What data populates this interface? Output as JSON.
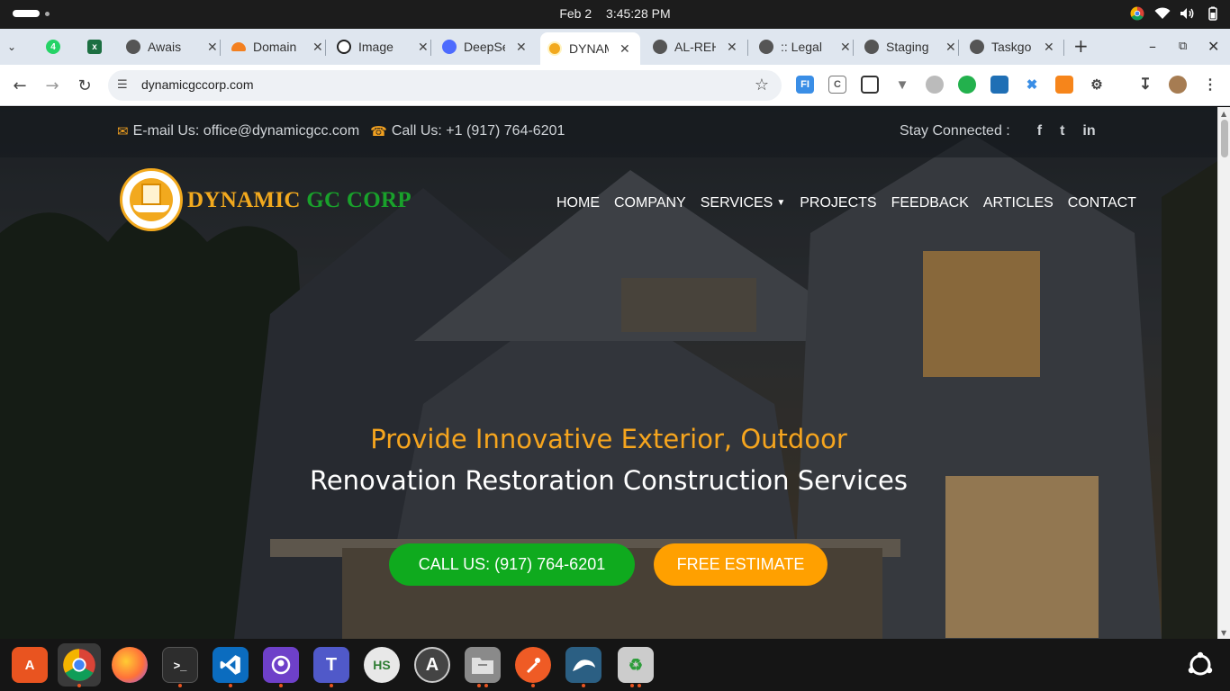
{
  "os": {
    "date": "Feb 2",
    "time": "3:45:28 PM"
  },
  "tabs": [
    {
      "title": "",
      "icon": "whatsapp-icon",
      "color": "#25d366"
    },
    {
      "title": "",
      "icon": "excel-icon",
      "color": "#1d6f42"
    },
    {
      "title": "Awais",
      "icon": "globe-icon",
      "color": "#555555"
    },
    {
      "title": "Domain",
      "icon": "cloudflare-icon",
      "color": "#f38020"
    },
    {
      "title": "Image",
      "icon": "openai-icon",
      "color": "#222222"
    },
    {
      "title": "DeepSeek",
      "icon": "deepseek-icon",
      "color": "#4d6bfe"
    },
    {
      "title": "DYNAMIC",
      "icon": "dynamic-gc-icon",
      "color": "#f2a91e"
    },
    {
      "title": "AL-REH",
      "icon": "globe-icon",
      "color": "#555555"
    },
    {
      "title": ":: Legal",
      "icon": "globe-icon",
      "color": "#555555"
    },
    {
      "title": "Staging",
      "icon": "globe-icon",
      "color": "#555555"
    },
    {
      "title": "Taskgo",
      "icon": "globe-icon",
      "color": "#555555"
    }
  ],
  "toolbar": {
    "url": "dynamicgccorp.com",
    "new_tab": "+"
  },
  "site": {
    "email_label": "E-mail Us: office@dynamicgcc.com",
    "phone_label": "Call Us: +1 (917) 764-6201",
    "stay_connected": "Stay Connected :",
    "social": [
      "f",
      "t",
      "in"
    ],
    "brand_part1": "DYNAMIC",
    "brand_part2": "GC CORP",
    "nav": [
      "HOME",
      "COMPANY",
      "SERVICES",
      "PROJECTS",
      "FEEDBACK",
      "ARTICLES",
      "CONTACT"
    ],
    "hero_line1": "Provide Innovative Exterior, Outdoor",
    "hero_line2": "Renovation Restoration Construction Services",
    "cta_call": "CALL US: (917) 764-6201",
    "cta_estimate": "FREE ESTIMATE"
  },
  "colors": {
    "accent_orange": "#f2a91e",
    "accent_green": "#19a12b",
    "call_button": "#0faa1e",
    "estimate_button": "#ffa000"
  },
  "dock": [
    {
      "name": "app-center-icon",
      "color": "#e95420",
      "label": "A"
    },
    {
      "name": "chrome-icon",
      "color": "#4285f4",
      "label": ""
    },
    {
      "name": "firefox-icon",
      "color": "#ff7139",
      "label": ""
    },
    {
      "name": "terminal-icon",
      "color": "#333333",
      "label": ">_"
    },
    {
      "name": "vscode-icon",
      "color": "#0078d4",
      "label": ""
    },
    {
      "name": "github-desktop-icon",
      "color": "#6e40c9",
      "label": ""
    },
    {
      "name": "teams-icon",
      "color": "#5059c9",
      "label": "T"
    },
    {
      "name": "hubstaff-icon",
      "color": "#2e7d32",
      "label": "HS"
    },
    {
      "name": "software-updater-icon",
      "color": "#555555",
      "label": "A"
    },
    {
      "name": "files-icon",
      "color": "#777777",
      "label": ""
    },
    {
      "name": "postman-icon",
      "color": "#ef5b25",
      "label": ""
    },
    {
      "name": "mysql-workbench-icon",
      "color": "#2b5f83",
      "label": ""
    },
    {
      "name": "trash-icon",
      "color": "#888888",
      "label": ""
    }
  ]
}
